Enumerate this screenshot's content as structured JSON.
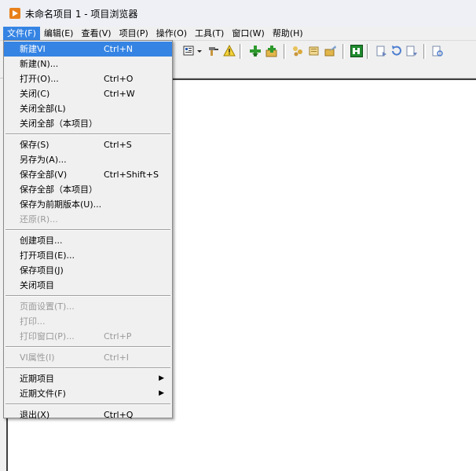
{
  "window": {
    "title": "未命名项目 1 - 项目浏览器"
  },
  "menubar": [
    {
      "label": "文件(F)",
      "active": true
    },
    {
      "label": "编辑(E)"
    },
    {
      "label": "查看(V)"
    },
    {
      "label": "项目(P)"
    },
    {
      "label": "操作(O)"
    },
    {
      "label": "工具(T)"
    },
    {
      "label": "窗口(W)"
    },
    {
      "label": "帮助(H)"
    }
  ],
  "file_menu": {
    "items": [
      {
        "label": "新建VI",
        "shortcut": "Ctrl+N",
        "highlighted": true
      },
      {
        "label": "新建(N)...",
        "shortcut": ""
      },
      {
        "label": "打开(O)...",
        "shortcut": "Ctrl+O"
      },
      {
        "label": "关闭(C)",
        "shortcut": "Ctrl+W"
      },
      {
        "label": "关闭全部(L)",
        "shortcut": ""
      },
      {
        "label": "关闭全部（本项目）",
        "shortcut": ""
      },
      {
        "separator": true
      },
      {
        "label": "保存(S)",
        "shortcut": "Ctrl+S"
      },
      {
        "label": "另存为(A)...",
        "shortcut": ""
      },
      {
        "label": "保存全部(V)",
        "shortcut": "Ctrl+Shift+S"
      },
      {
        "label": "保存全部（本项目）",
        "shortcut": ""
      },
      {
        "label": "保存为前期版本(U)...",
        "shortcut": ""
      },
      {
        "label": "还原(R)...",
        "shortcut": "",
        "disabled": true
      },
      {
        "separator": true
      },
      {
        "label": "创建项目...",
        "shortcut": ""
      },
      {
        "label": "打开项目(E)...",
        "shortcut": ""
      },
      {
        "label": "保存项目(J)",
        "shortcut": ""
      },
      {
        "label": "关闭项目",
        "shortcut": ""
      },
      {
        "separator": true
      },
      {
        "label": "页面设置(T)...",
        "shortcut": "",
        "disabled": true
      },
      {
        "label": "打印...",
        "shortcut": "",
        "disabled": true
      },
      {
        "label": "打印窗口(P)...",
        "shortcut": "Ctrl+P",
        "disabled": true
      },
      {
        "separator": true
      },
      {
        "label": "VI属性(I)",
        "shortcut": "Ctrl+I",
        "disabled": true
      },
      {
        "separator": true
      },
      {
        "label": "近期项目",
        "shortcut": "",
        "submenu": true
      },
      {
        "label": "近期文件(F)",
        "shortcut": "",
        "submenu": true
      },
      {
        "separator": true
      },
      {
        "label": "退出(X)",
        "shortcut": "Ctrl+Q"
      }
    ]
  },
  "toolbar_icons": [
    "new-file-icon",
    "open-folder-icon",
    "save-all-icon",
    "cut-icon",
    "copy-icon",
    "paste-icon",
    "delete-icon",
    "add-to-project-icon",
    "dropdown-icon",
    "build-icon",
    "warning-icon",
    "add-item-icon",
    "add-folder-icon",
    "properties-icon",
    "dependencies-icon",
    "build-spec-icon",
    "vi-icon",
    "view-hierarchy-icon",
    "refresh-icon",
    "expand-icon",
    "find-icon"
  ],
  "colors": {
    "accent": "#3584e4",
    "app_icon": "#e8801a",
    "disabled_text": "#9a9a9a"
  }
}
